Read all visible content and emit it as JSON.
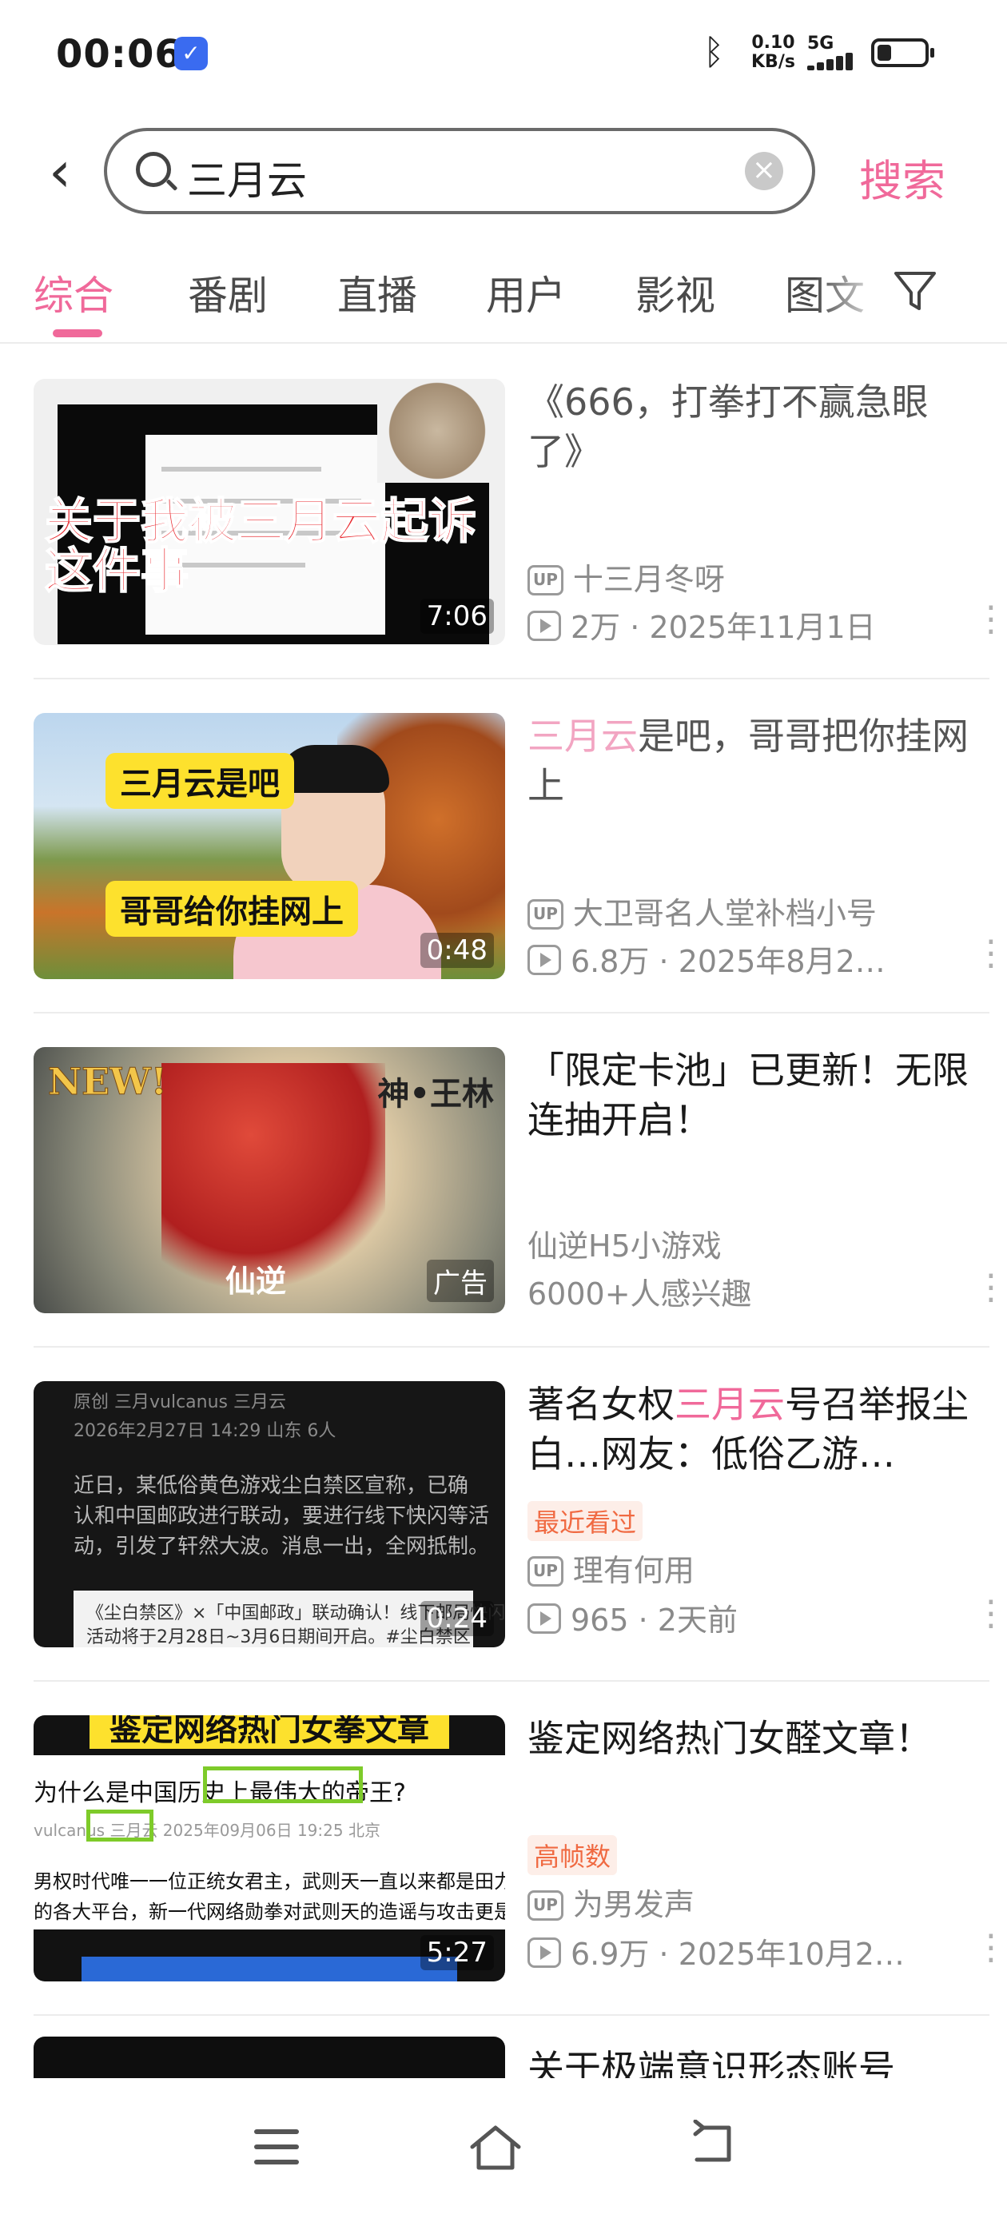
{
  "status_bar": {
    "time": "00:06",
    "net_speed_value": "0.10",
    "net_speed_unit": "KB/s",
    "network": "5G",
    "battery_level": 0.3
  },
  "search": {
    "query": "三月云",
    "submit_label": "搜索"
  },
  "tabs": [
    {
      "label": "综合",
      "active": true
    },
    {
      "label": "番剧"
    },
    {
      "label": "直播"
    },
    {
      "label": "用户"
    },
    {
      "label": "影视"
    },
    {
      "label": "图文"
    }
  ],
  "results": [
    {
      "title": "《666，打拳打不赢急眼了》",
      "uploader": "十三月冬呀",
      "views": "2万",
      "date": "2025年11月1日",
      "duration": "7:06",
      "thumb_caption_line1": "关于我被三月云起诉",
      "thumb_caption_line2": "这件事"
    },
    {
      "title_highlight": "三月云",
      "title_rest": "是吧，哥哥把你挂网上",
      "uploader": "大卫哥名人堂补档小号",
      "views": "6.8万",
      "date": "2025年8月2…",
      "duration": "0:48",
      "thumb_caption_top": "三月云是吧",
      "thumb_caption_bottom": "哥哥给你挂网上"
    },
    {
      "title": "「限定卡池」已更新！无限连抽开启！",
      "advertiser": "仙逆H5小游戏",
      "interest": "6000+人感兴趣",
      "ad_label": "广告",
      "thumb_new": "NEW!",
      "thumb_name": "神•王林",
      "thumb_logo": "仙逆"
    },
    {
      "title_pre": "著名女权",
      "title_highlight": "三月云",
      "title_rest": "号召举报尘白…网友：低俗乙游…",
      "badge": "最近看过",
      "uploader": "理有何用",
      "views": "965",
      "date": "2天前",
      "duration": "0:24",
      "thumb_lines": [
        "原创  三月vulcanus  三月云",
        "2026年2月27日 14:29  山东  6人",
        "近日，某低俗黄色游戏尘白禁区宣称，已确",
        "认和中国邮政进行联动，要进行线下快闪等活",
        "动，引发了轩然大波。消息一出，全网抵制。"
      ],
      "thumb_box_lines": [
        "《尘白禁区》×「中国邮政」联动确认！线下邮局快闪",
        "活动将于2月28日~3月6日期间开启。#尘白禁区"
      ]
    },
    {
      "title": "鉴定网络热门女醛文章！",
      "badge": "高帧数",
      "uploader": "为男发声",
      "views": "6.9万",
      "date": "2025年10月2…",
      "duration": "5:27",
      "thumb_top_caption": "鉴定网络热门女拳文章",
      "thumb_question": "为什么是中国历史上最伟大的帝王?",
      "thumb_author_line": "vulcanus  三月云  2025年09月06日 19:25 北京",
      "thumb_body1": "男权时代唯一一位正统女君主，武则天一直以来都是田力攻击和造谣",
      "thumb_body2": "的各大平台，新一代网络勋拳对武则天的造谣与攻击更是甚嚣尘上"
    }
  ],
  "partial_result": {
    "title": "关于极端意识形态账号"
  },
  "colors": {
    "accent": "#f0699a",
    "badge": "#f06a42",
    "meta": "#8a8a8a"
  }
}
